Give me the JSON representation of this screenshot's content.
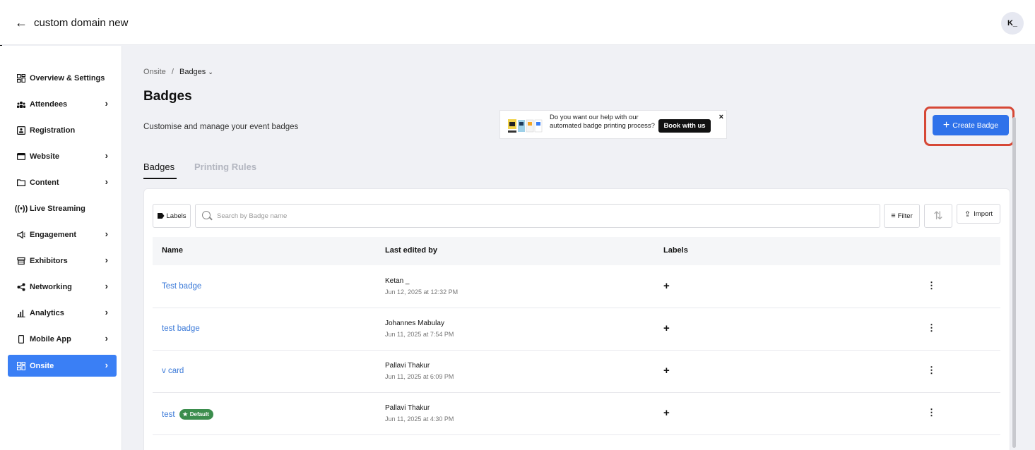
{
  "topbar": {
    "title": "custom domain new",
    "avatar": "K_"
  },
  "sidebar": {
    "items": [
      {
        "label": "Overview & Settings",
        "icon": "grid-icon",
        "chevron": false
      },
      {
        "label": "Attendees",
        "icon": "people-icon",
        "chevron": true
      },
      {
        "label": "Registration",
        "icon": "id-card-icon",
        "chevron": false
      },
      {
        "label": "Website",
        "icon": "browser-icon",
        "chevron": true
      },
      {
        "label": "Content",
        "icon": "folder-icon",
        "chevron": true
      },
      {
        "label": "Live Streaming",
        "icon": "broadcast-icon",
        "chevron": false
      },
      {
        "label": "Engagement",
        "icon": "megaphone-icon",
        "chevron": true
      },
      {
        "label": "Exhibitors",
        "icon": "store-icon",
        "chevron": true
      },
      {
        "label": "Networking",
        "icon": "share-icon",
        "chevron": true
      },
      {
        "label": "Analytics",
        "icon": "bar-chart-icon",
        "chevron": true
      },
      {
        "label": "Mobile App",
        "icon": "phone-icon",
        "chevron": true
      },
      {
        "label": "Onsite",
        "icon": "grid-icon",
        "chevron": true,
        "active": true
      }
    ]
  },
  "breadcrumb": {
    "root": "Onsite",
    "separator": "/",
    "current": "Badges"
  },
  "page": {
    "title": "Badges",
    "subtitle": "Customise and manage your event badges"
  },
  "promo": {
    "text": "Do you want our help with our automated badge printing process?",
    "button": "Book with us",
    "close": "×"
  },
  "actions": {
    "create_badge": "Create Badge"
  },
  "tabs": [
    {
      "label": "Badges",
      "active": true
    },
    {
      "label": "Printing Rules",
      "active": false
    }
  ],
  "toolbar": {
    "labels": "Labels",
    "search_placeholder": "Search by Badge name",
    "filter": "Filter",
    "import": "Import"
  },
  "table": {
    "columns": [
      "Name",
      "Last edited by",
      "Labels"
    ],
    "rows": [
      {
        "name": "Test badge",
        "editor": "Ketan _",
        "date": "Jun 12, 2025 at 12:32 PM",
        "default": false
      },
      {
        "name": "test badge",
        "editor": "Johannes Mabulay",
        "date": "Jun 11, 2025 at 7:54 PM",
        "default": false
      },
      {
        "name": "v card",
        "editor": "Pallavi Thakur",
        "date": "Jun 11, 2025 at 6:09 PM",
        "default": false
      },
      {
        "name": "test",
        "editor": "Pallavi Thakur",
        "date": "Jun 11, 2025 at 4:30 PM",
        "default": true,
        "badge": "Default"
      }
    ]
  },
  "colors": {
    "accent": "#2f72ea",
    "active_nav": "#3a7ff5",
    "link": "#3a79d8",
    "default_badge": "#3b8d4d",
    "highlight": "#d64836"
  }
}
